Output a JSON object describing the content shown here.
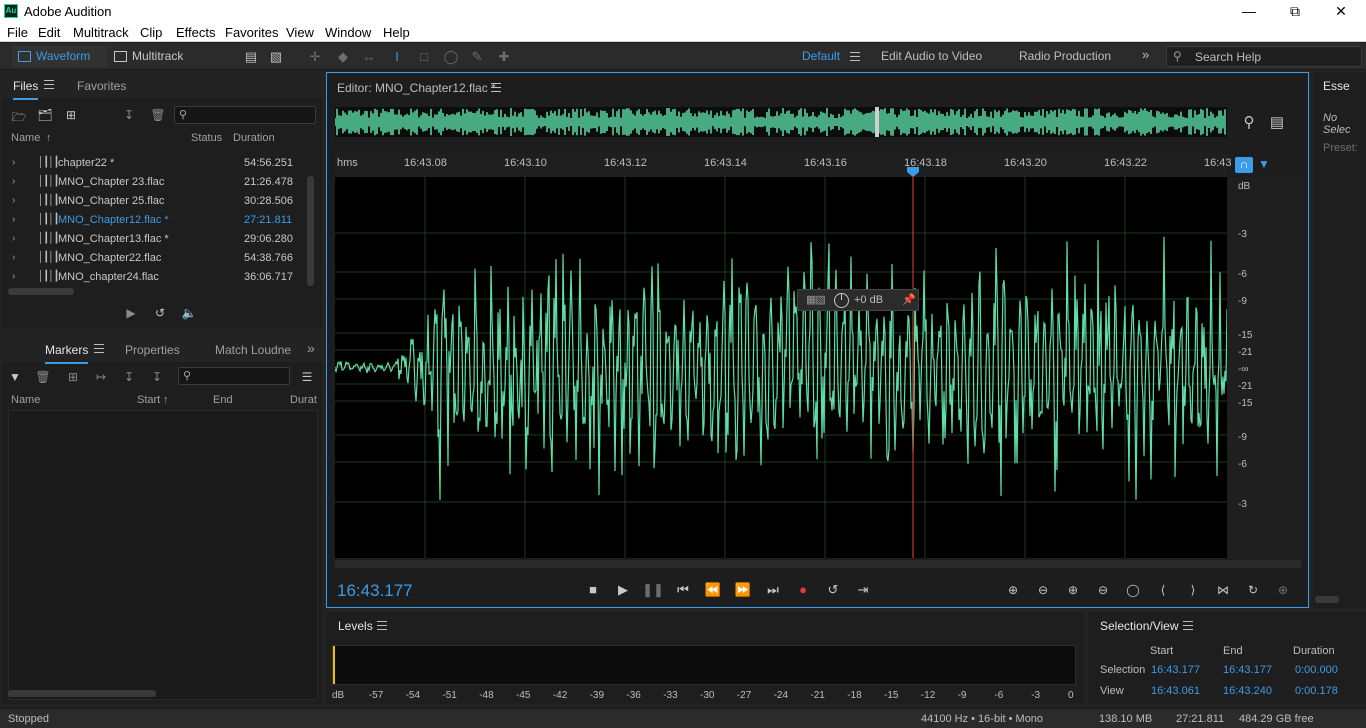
{
  "window": {
    "title": "Adobe Audition",
    "icon_label": "Au"
  },
  "menu": [
    "File",
    "Edit",
    "Multitrack",
    "Clip",
    "Effects",
    "Favorites",
    "View",
    "Window",
    "Help"
  ],
  "toolbar": {
    "waveform_label": "Waveform",
    "multitrack_label": "Multitrack",
    "workspaces": [
      "Default",
      "Edit Audio to Video",
      "Radio Production"
    ],
    "search_placeholder": "Search Help"
  },
  "files_panel": {
    "tabs": [
      "Files",
      "Favorites"
    ],
    "columns": {
      "name": "Name",
      "status": "Status",
      "duration": "Duration"
    },
    "rows": [
      {
        "name": "chapter22 *",
        "duration": "54:56.251",
        "selected": false
      },
      {
        "name": "MNO_Chapter 23.flac",
        "duration": "21:26.478",
        "selected": false
      },
      {
        "name": "MNO_Chapter 25.flac",
        "duration": "30:28.506",
        "selected": false
      },
      {
        "name": "MNO_Chapter12.flac *",
        "duration": "27:21.811",
        "selected": true
      },
      {
        "name": "MNO_Chapter13.flac *",
        "duration": "29:06.280",
        "selected": false
      },
      {
        "name": "MNO_Chapter22.flac",
        "duration": "54:38.766",
        "selected": false
      },
      {
        "name": "MNO_chapter24.flac",
        "duration": "36:06.717",
        "selected": false
      }
    ]
  },
  "markers_panel": {
    "tabs": [
      "Markers",
      "Properties",
      "Match Loudne"
    ],
    "columns": {
      "name": "Name",
      "start": "Start",
      "end": "End",
      "duration": "Durat"
    }
  },
  "editor": {
    "title": "Editor: MNO_Chapter12.flac *",
    "ruler_unit": "hms",
    "ruler_ticks": [
      "16:43.08",
      "16:43.10",
      "16:43.12",
      "16:43.14",
      "16:43.16",
      "16:43.18",
      "16:43.20",
      "16:43.22",
      "16:43"
    ],
    "db_unit": "dB",
    "db_labels": [
      "-3",
      "-6",
      "-9",
      "-15",
      "-21",
      "-∞",
      "-21",
      "-15",
      "-9",
      "-6",
      "-3"
    ],
    "hud_value": "+0 dB",
    "current_time": "16:43.177"
  },
  "right_panel": {
    "tab": "Esse",
    "text1": "No Selec",
    "text2": "Preset:"
  },
  "levels": {
    "title": "Levels",
    "scale": [
      "dB",
      "-57",
      "-54",
      "-51",
      "-48",
      "-45",
      "-42",
      "-39",
      "-36",
      "-33",
      "-30",
      "-27",
      "-24",
      "-21",
      "-18",
      "-15",
      "-12",
      "-9",
      "-6",
      "-3",
      "0"
    ]
  },
  "selection_view": {
    "title": "Selection/View",
    "headers": {
      "start": "Start",
      "end": "End",
      "duration": "Duration"
    },
    "selection": {
      "label": "Selection",
      "start": "16:43.177",
      "end": "16:43.177",
      "duration": "0:00.000"
    },
    "view": {
      "label": "View",
      "start": "16:43.061",
      "end": "16:43.240",
      "duration": "0:00.178"
    }
  },
  "status": {
    "state": "Stopped",
    "format": "44100 Hz • 16-bit • Mono",
    "size": "138.10 MB",
    "duration": "27:21.811",
    "free": "484.29 GB free"
  },
  "colors": {
    "accent": "#3b9ce8",
    "waveform": "#5ddfa6",
    "playhead": "#c0392b",
    "background": "#232323"
  }
}
